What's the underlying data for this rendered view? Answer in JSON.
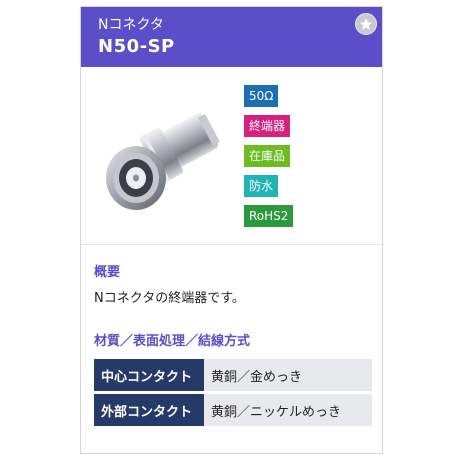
{
  "header": {
    "subtitle": "Nコネクタ",
    "title": "N50-SP"
  },
  "favorite": {
    "icon": "star-icon"
  },
  "badges": [
    {
      "label": "50Ω",
      "color": "#1d6fb5"
    },
    {
      "label": "終端器",
      "color": "#d8207e"
    },
    {
      "label": "在庫品",
      "color": "#6cbc22"
    },
    {
      "label": "防水",
      "color": "#20b4b4"
    },
    {
      "label": "RoHS2",
      "color": "#2a9a3f"
    }
  ],
  "overview": {
    "heading": "概要",
    "text": "Nコネクタの終端器です。"
  },
  "materials": {
    "heading": "材質／表面処理／結線方式",
    "rows": [
      {
        "label": "中心コンタクト",
        "value": "黄銅／金めっき"
      },
      {
        "label": "外部コンタクト",
        "value": "黄銅／ニッケルめっき"
      }
    ]
  }
}
